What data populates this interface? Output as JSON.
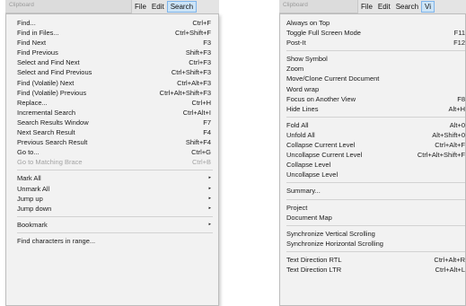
{
  "left": {
    "strip_text": "Clipboard",
    "menubar": [
      {
        "label": "File",
        "active": false
      },
      {
        "label": "Edit",
        "active": false
      },
      {
        "label": "Search",
        "active": true
      }
    ],
    "items": [
      {
        "label": "Find...",
        "shortcut": "Ctrl+F"
      },
      {
        "label": "Find in Files...",
        "shortcut": "Ctrl+Shift+F"
      },
      {
        "label": "Find Next",
        "shortcut": "F3"
      },
      {
        "label": "Find Previous",
        "shortcut": "Shift+F3"
      },
      {
        "label": "Select and Find Next",
        "shortcut": "Ctrl+F3"
      },
      {
        "label": "Select and Find Previous",
        "shortcut": "Ctrl+Shift+F3"
      },
      {
        "label": "Find (Volatile) Next",
        "shortcut": "Ctrl+Alt+F3"
      },
      {
        "label": "Find (Volatile) Previous",
        "shortcut": "Ctrl+Alt+Shift+F3"
      },
      {
        "label": "Replace...",
        "shortcut": "Ctrl+H"
      },
      {
        "label": "Incremental Search",
        "shortcut": "Ctrl+Alt+I"
      },
      {
        "label": "Search Results Window",
        "shortcut": "F7"
      },
      {
        "label": "Next Search Result",
        "shortcut": "F4"
      },
      {
        "label": "Previous Search Result",
        "shortcut": "Shift+F4"
      },
      {
        "label": "Go to...",
        "shortcut": "Ctrl+G"
      },
      {
        "label": "Go to Matching Brace",
        "shortcut": "Ctrl+B",
        "disabled": true
      },
      {
        "sep": true
      },
      {
        "label": "Mark All",
        "submenu": true
      },
      {
        "label": "Unmark All",
        "submenu": true
      },
      {
        "label": "Jump up",
        "submenu": true
      },
      {
        "label": "Jump down",
        "submenu": true
      },
      {
        "sep": true
      },
      {
        "label": "Bookmark",
        "submenu": true
      },
      {
        "sep": true
      },
      {
        "label": "Find characters in range..."
      }
    ]
  },
  "right": {
    "strip_text": "Clipboard",
    "menubar": [
      {
        "label": "File",
        "active": false
      },
      {
        "label": "Edit",
        "active": false
      },
      {
        "label": "Search",
        "active": false
      },
      {
        "label": "Vi",
        "active": true
      }
    ],
    "items": [
      {
        "label": "Always on Top"
      },
      {
        "label": "Toggle Full Screen Mode",
        "shortcut": "F11"
      },
      {
        "label": "Post-It",
        "shortcut": "F12"
      },
      {
        "sep": true
      },
      {
        "label": "Show Symbol"
      },
      {
        "label": "Zoom"
      },
      {
        "label": "Move/Clone Current Document"
      },
      {
        "label": "Word wrap"
      },
      {
        "label": "Focus on Another View",
        "shortcut": "F8"
      },
      {
        "label": "Hide Lines",
        "shortcut": "Alt+H"
      },
      {
        "sep": true
      },
      {
        "label": "Fold All",
        "shortcut": "Alt+0"
      },
      {
        "label": "Unfold All",
        "shortcut": "Alt+Shift+0"
      },
      {
        "label": "Collapse Current Level",
        "shortcut": "Ctrl+Alt+F"
      },
      {
        "label": "Uncollapse Current Level",
        "shortcut": "Ctrl+Alt+Shift+F"
      },
      {
        "label": "Collapse Level"
      },
      {
        "label": "Uncollapse Level"
      },
      {
        "sep": true
      },
      {
        "label": "Summary..."
      },
      {
        "sep": true
      },
      {
        "label": "Project"
      },
      {
        "label": "Document Map"
      },
      {
        "sep": true
      },
      {
        "label": "Synchronize Vertical Scrolling"
      },
      {
        "label": "Synchronize Horizontal Scrolling"
      },
      {
        "sep": true
      },
      {
        "label": "Text Direction RTL",
        "shortcut": "Ctrl+Alt+R"
      },
      {
        "label": "Text Direction LTR",
        "shortcut": "Ctrl+Alt+L"
      }
    ]
  }
}
